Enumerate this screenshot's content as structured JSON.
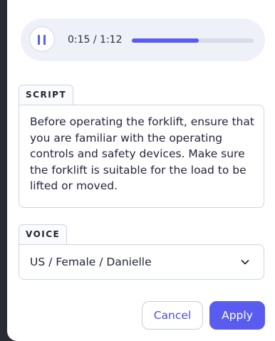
{
  "player": {
    "time": "0:15 / 1:12",
    "progress_fraction": 0.55,
    "pause_icon": "pause-icon"
  },
  "script": {
    "label": "SCRIPT",
    "text": "Before operating the forklift, ensure that you are familiar with the operating controls and safety devices. Make sure the forklift is suitable for the load to be lifted or moved."
  },
  "voice": {
    "label": "VOICE",
    "selected": "US / Female / Danielle",
    "dropdown_icon": "chevron-down-icon"
  },
  "actions": {
    "cancel_label": "Cancel",
    "apply_label": "Apply"
  },
  "colors": {
    "accent": "#5a5cf0",
    "track": "#d9dbe8",
    "player_bg": "#eef1f7",
    "backdrop": "#2a2c33"
  }
}
